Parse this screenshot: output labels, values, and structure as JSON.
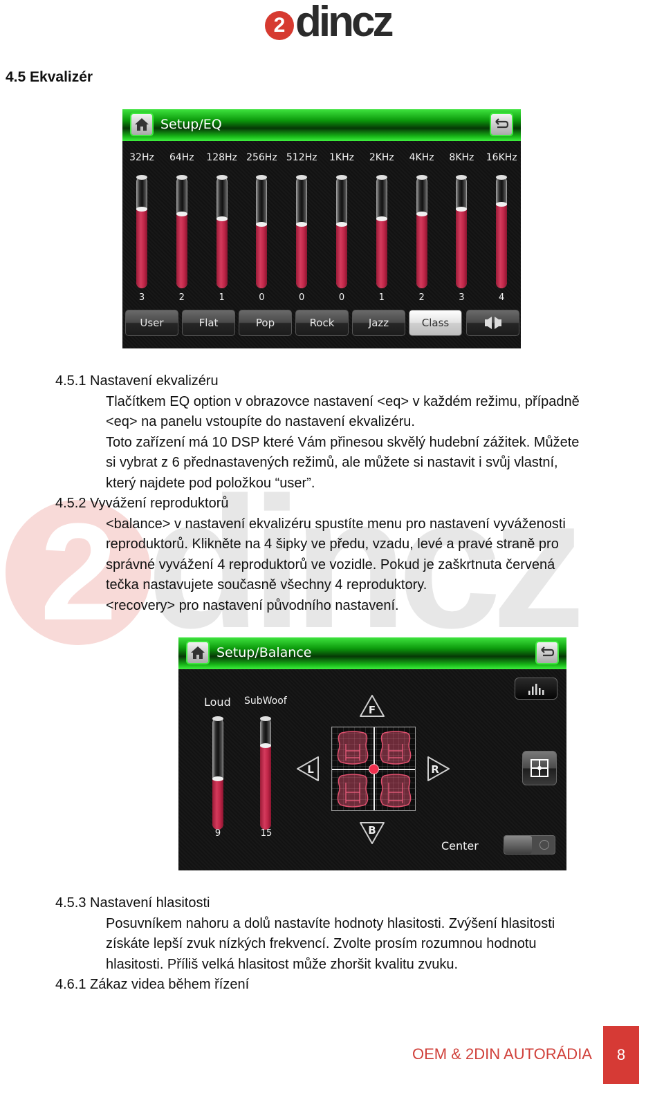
{
  "logo": {
    "number": "2",
    "text": "dincz"
  },
  "watermark": {
    "number": "2",
    "text": "dincz"
  },
  "section_title": "4.5 Ekvalizér",
  "eq_screen": {
    "title": "Setup/EQ",
    "home_icon": "home-icon",
    "back_icon": "back-arrow-icon",
    "accent_color": "#1fd01f",
    "bands": [
      {
        "label": "32Hz",
        "value": "3"
      },
      {
        "label": "64Hz",
        "value": "2"
      },
      {
        "label": "128Hz",
        "value": "1"
      },
      {
        "label": "256Hz",
        "value": "0"
      },
      {
        "label": "512Hz",
        "value": "0"
      },
      {
        "label": "1KHz",
        "value": "0"
      },
      {
        "label": "2KHz",
        "value": "1"
      },
      {
        "label": "4KHz",
        "value": "2"
      },
      {
        "label": "8KHz",
        "value": "3"
      },
      {
        "label": "16KHz",
        "value": "4"
      }
    ],
    "presets": [
      {
        "label": "User",
        "active": false
      },
      {
        "label": "Flat",
        "active": false
      },
      {
        "label": "Pop",
        "active": false
      },
      {
        "label": "Rock",
        "active": false
      },
      {
        "label": "Jazz",
        "active": false
      },
      {
        "label": "Class",
        "active": true
      }
    ],
    "balance_button_icon": "speaker-balance-icon"
  },
  "section_451": {
    "heading": "4.5.1 Nastavení ekvalizéru",
    "lines": [
      "Tlačítkem EQ option v obrazovce nastavení <eq> v každém režimu, případně",
      "<eq> na panelu vstoupíte do nastavení ekvalizéru.",
      "Toto zařízení má 10 DSP které Vám přinesou skvělý hudební zážitek. Můžete",
      "si vybrat z 6 přednastavených režimů, ale můžete si nastavit i svůj vlastní,",
      "který najdete pod položkou “user”."
    ]
  },
  "section_452": {
    "heading": "4.5.2 Vyvážení reproduktorů",
    "lines": [
      "<balance> v nastavení ekvalizéru spustíte menu pro nastavení vyváženosti",
      "reproduktorů. Klikněte na 4 šipky ve předu, vzadu, levé a pravé straně pro",
      "správné vyvážení 4 reproduktorů ve vozidle. Pokud je zaškrtnuta červená",
      "tečka nastavujete současně všechny 4 reproduktory.",
      "<recovery> pro nastavení původního nastavení."
    ]
  },
  "balance_screen": {
    "title": "Setup/Balance",
    "loud": {
      "label": "Loud",
      "value": "9",
      "level": 0.45
    },
    "subwoof": {
      "label": "SubWoof",
      "value": "15",
      "level": 0.75
    },
    "arrows": {
      "front": "F",
      "back": "B",
      "left": "L",
      "right": "R"
    },
    "center_label": "Center",
    "center_toggle_on": false,
    "seat_color": "#e0506e",
    "dot_color": "#f0304e"
  },
  "section_453": {
    "heading": "4.5.3 Nastavení hlasitosti",
    "lines": [
      "Posuvníkem nahoru a dolů nastavíte hodnoty hlasitosti. Zvýšení hlasitosti",
      "získáte lepší zvuk nízkých frekvencí. Zvolte prosím rozumnou hodnotu",
      "hlasitosti. Příliš velká hlasitost může zhoršit kvalitu zvuku."
    ]
  },
  "section_461": {
    "heading": "4.6.1 Zákaz videa během řízení"
  },
  "footer": {
    "text": "OEM & 2DIN AUTORÁDIA",
    "page": "8",
    "color": "#d63a35"
  }
}
